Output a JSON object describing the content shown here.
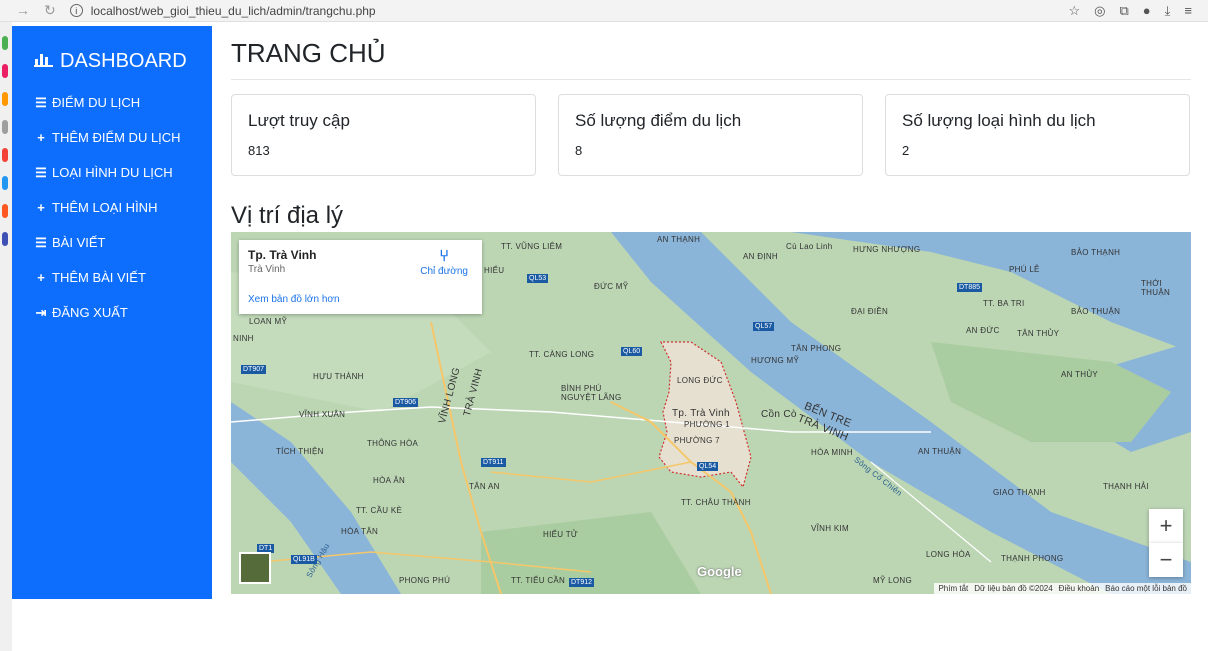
{
  "browser": {
    "url": "localhost/web_gioi_thieu_du_lich/admin/trangchu.php"
  },
  "sidebar": {
    "brand": "DASHBOARD",
    "items": [
      {
        "icon": "list-icon",
        "label": "ĐIỂM DU LỊCH"
      },
      {
        "icon": "plus-icon",
        "label": "THÊM ĐIỂM DU LỊCH"
      },
      {
        "icon": "list-icon",
        "label": "LOẠI HÌNH DU LỊCH"
      },
      {
        "icon": "plus-icon",
        "label": "THÊM LOẠI HÌNH"
      },
      {
        "icon": "list-icon",
        "label": "BÀI VIẾT"
      },
      {
        "icon": "plus-icon",
        "label": "THÊM BÀI VIẾT"
      },
      {
        "icon": "sign-out-icon",
        "label": "ĐĂNG XUẤT"
      }
    ],
    "color": "#0d6efd"
  },
  "main": {
    "title": "TRANG CHỦ",
    "cards": [
      {
        "title": "Lượt truy cập",
        "value": "813"
      },
      {
        "title": "Số lượng điểm du lịch",
        "value": "8"
      },
      {
        "title": "Số lượng loại hình du lịch",
        "value": "2"
      }
    ],
    "section_title": "Vị trí địa lý"
  },
  "map": {
    "popup_title": "Tp. Trà Vinh",
    "popup_sub": "Trà Vinh",
    "directions_label": "Chỉ đường",
    "larger_map_link": "Xem bản đồ lớn hơn",
    "zoom_in": "+",
    "zoom_out": "−",
    "logo": "Google",
    "attribution": [
      "Phím tắt",
      "Dữ liệu bản đồ ©2024",
      "Điều khoản",
      "Báo cáo một lỗi bản đồ"
    ],
    "labels": [
      "Cù Lao Linh",
      "AN ĐỊNH",
      "HƯNG NHƯỢNG",
      "BẢO THẠNH",
      "PHÚ LỄ",
      "THỚI THUẬN",
      "ĐỨC MỸ",
      "ĐẠI ĐIỀN",
      "BẢO THUẬN",
      "TÂN THỦY",
      "AN ĐỨC",
      "TÂN PHONG",
      "HƯƠNG MỸ",
      "LONG ĐỨC",
      "AN THỦY",
      "Tp. Trà Vinh",
      "PHƯỜNG 1",
      "PHƯỜNG 7",
      "Cồn Cò",
      "BẾN TRE",
      "TRÀ VINH",
      "HÒA MINH",
      "AN THUẬN",
      "GIAO THẠNH",
      "THẠNH HẢI",
      "VĨNH KIM",
      "LONG HÒA",
      "THẠNH PHONG",
      "MỸ LONG",
      "TT. CHÂU THÀNH",
      "HIẾU TỬ",
      "TT. TIỂU CẦN",
      "PHONG PHÚ",
      "HÒA TÂN",
      "TT. CẦU KÈ",
      "HÒA ÂN",
      "TÂN AN",
      "THÔNG HÒA",
      "TÍCH THIỆN",
      "VĨNH XUÂN",
      "HỰU THÀNH",
      "VĨNH LONG",
      "TRÀ VINH",
      "TT. CÀNG LONG",
      "BÌNH PHÚ",
      "NGUYỆT LÃNG",
      "TT. VŨNG LIÊM",
      "HIẾU",
      "LOAN MỸ",
      "NINH",
      "AN THẠNH",
      "TT. BA TRI",
      "Sông Cổ Chiên",
      "Sông Hậu"
    ],
    "roads": [
      "QL53",
      "QL57",
      "QL60",
      "QL54",
      "DT907",
      "DT906",
      "DT911",
      "DT912",
      "DT885",
      "QL91B",
      "DT1"
    ]
  }
}
